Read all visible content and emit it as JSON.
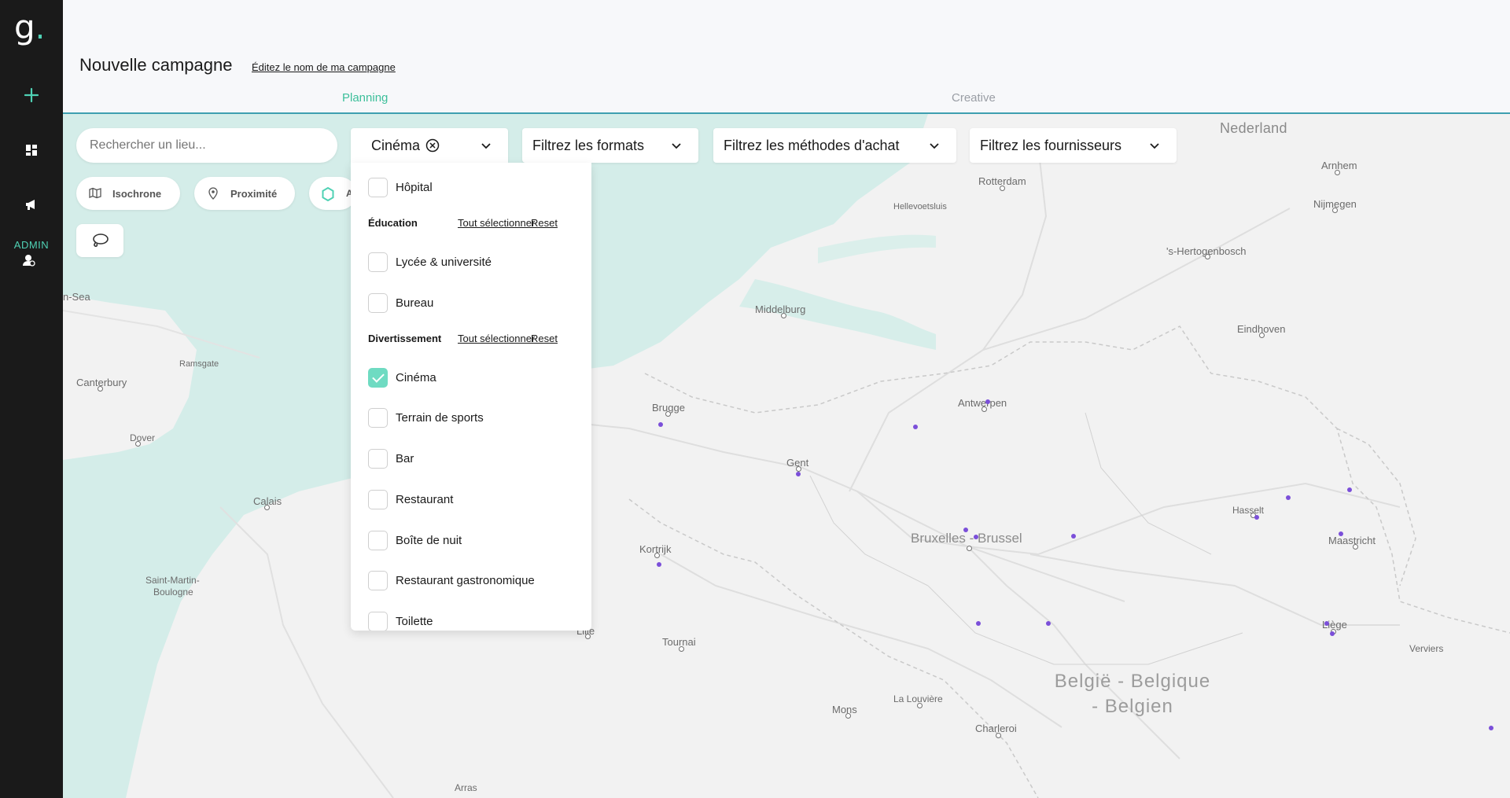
{
  "sidebar": {
    "logo": "g",
    "admin_label": "ADMIN"
  },
  "header": {
    "title": "Nouvelle campagne",
    "edit_link": "Éditez le nom de ma campagne",
    "tabs": [
      {
        "label": "Planning",
        "active": true
      },
      {
        "label": "Creative",
        "active": false
      }
    ]
  },
  "search": {
    "placeholder": "Rechercher un lieu..."
  },
  "filters": {
    "category": "Cinéma",
    "formats": "Filtrez les formats",
    "methods": "Filtrez les méthodes d'achat",
    "suppliers": "Filtrez les fournisseurs"
  },
  "tools": {
    "isochrone": "Isochrone",
    "proximity": "Proximité",
    "partial": "A"
  },
  "dropdown": {
    "items_top": [
      {
        "label": "Hôpital",
        "checked": false
      }
    ],
    "sections": [
      {
        "title": "Éducation",
        "select_all": "Tout sélectionner",
        "reset": "Reset"
      },
      {
        "title": "Divertissement",
        "select_all": "Tout sélectionner",
        "reset": "Reset"
      }
    ],
    "education_items": [
      {
        "label": "Lycée & université",
        "checked": false
      },
      {
        "label": "Bureau",
        "checked": false
      }
    ],
    "entertainment_items": [
      {
        "label": "Cinéma",
        "checked": true
      },
      {
        "label": "Terrain de sports",
        "checked": false
      },
      {
        "label": "Bar",
        "checked": false
      },
      {
        "label": "Restaurant",
        "checked": false
      },
      {
        "label": "Boîte de nuit",
        "checked": false
      },
      {
        "label": "Restaurant gastronomique",
        "checked": false
      },
      {
        "label": "Toilette",
        "checked": false
      }
    ]
  },
  "map": {
    "countries": {
      "nl": "Nederland",
      "be_line1": "België - Belgique",
      "be_line2": "- Belgien"
    },
    "cities": {
      "rotterdam": "Rotterdam",
      "arnhem": "Arnhem",
      "nijmegen": "Nijmegen",
      "hellevoetsluis": "Hellevoetsluis",
      "hertogenbosch": "'s-Hertogenbosch",
      "middelburg": "Middelburg",
      "eindhoven": "Eindhoven",
      "sea": "n-Sea",
      "ramsgate": "Ramsgate",
      "canterbury": "Canterbury",
      "brugge": "Brugge",
      "antwerpen": "Antwerpen",
      "dover": "Dover",
      "gent": "Gent",
      "calais": "Calais",
      "hasselt": "Hasselt",
      "bruxelles": "Bruxelles - Brussel",
      "maastricht": "Maastricht",
      "kortrijk": "Kortrijk",
      "saint_martin_1": "Saint-Martin-",
      "saint_martin_2": "Boulogne",
      "lille": "Lille",
      "tournai": "Tournai",
      "liege": "Liège",
      "verviers": "Verviers",
      "mons": "Mons",
      "la_louviere": "La Louvière",
      "charleroi": "Charleroi",
      "arras": "Arras"
    },
    "colors": {
      "sea": "#d4ede9",
      "land": "#f2f2f2",
      "poi": "#7b4fd9",
      "accent": "#3cbf9a"
    }
  }
}
